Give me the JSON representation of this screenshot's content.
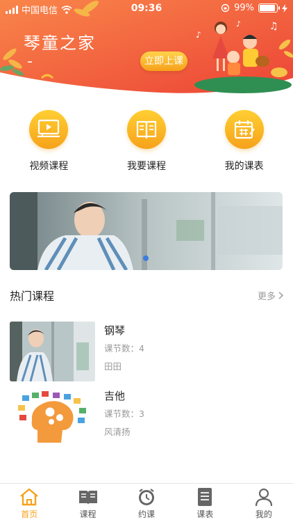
{
  "status_bar": {
    "carrier": "中国电信",
    "time": "09:36",
    "battery": "99%"
  },
  "header": {
    "title": "琴童之家",
    "start_button": "立即上课"
  },
  "quick_entries": [
    {
      "label": "视频课程",
      "icon": "video-course-icon"
    },
    {
      "label": "我要课程",
      "icon": "book-icon"
    },
    {
      "label": "我的课表",
      "icon": "calendar-icon"
    }
  ],
  "banner": {
    "page_count": 1,
    "active_page": 1
  },
  "hot_courses": {
    "title": "热门课程",
    "more": "更多",
    "items": [
      {
        "name": "钢琴",
        "lessons": "课节数：4",
        "teacher": "田田"
      },
      {
        "name": "吉他",
        "lessons": "课节数：3",
        "teacher": "风清扬"
      }
    ]
  },
  "tabbar": [
    {
      "label": "首页",
      "icon": "home-icon",
      "active": true
    },
    {
      "label": "课程",
      "icon": "open-book-icon",
      "active": false
    },
    {
      "label": "约课",
      "icon": "clock-icon",
      "active": false
    },
    {
      "label": "课表",
      "icon": "list-doc-icon",
      "active": false
    },
    {
      "label": "我的",
      "icon": "person-icon",
      "active": false
    }
  ],
  "colors": {
    "accent": "#f6a21a",
    "header_start": "#f8773a",
    "header_end": "#ee4a3a"
  }
}
